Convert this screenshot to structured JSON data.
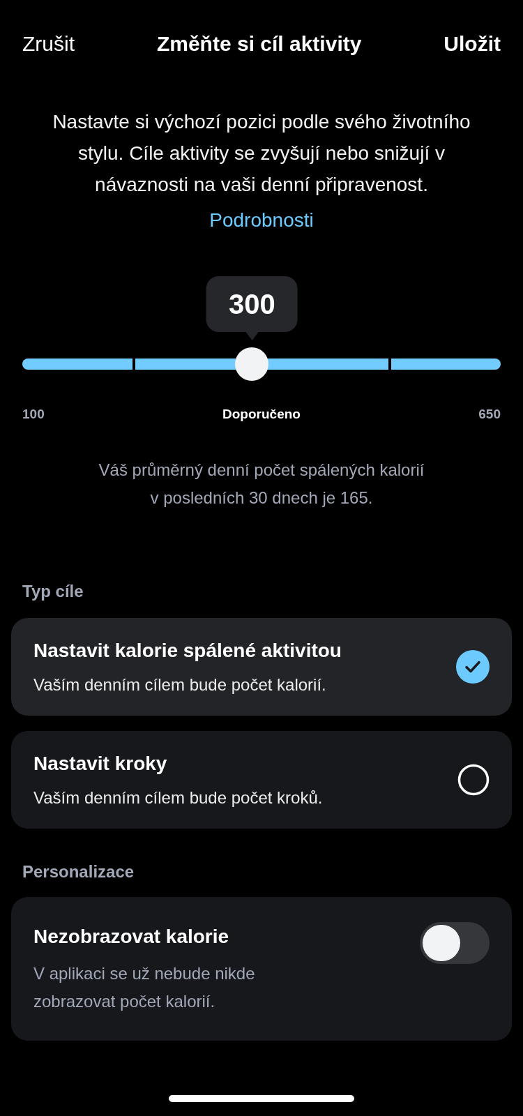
{
  "header": {
    "cancel": "Zrušit",
    "title": "Změňte si cíl aktivity",
    "save": "Uložit"
  },
  "intro": {
    "text": "Nastavte si výchozí pozici podle svého životního stylu. Cíle aktivity se zvyšují nebo snižují v návaznosti na vaši denní připravenost.",
    "link": "Podrobnosti"
  },
  "slider": {
    "value": "300",
    "level": 0.48,
    "min_label": "100",
    "center_label": "Doporučeno",
    "max_label": "650"
  },
  "average_note": "Váš průměrný denní počet spálených kalorií v posledních 30 dnech je 165.",
  "goal_type": {
    "heading": "Typ cíle",
    "options": [
      {
        "title": "Nastavit kalorie spálené aktivitou",
        "subtitle": "Vaším denním cílem bude počet kalorií.",
        "selected": true
      },
      {
        "title": "Nastavit kroky",
        "subtitle": "Vaším denním cílem bude počet kroků.",
        "selected": false
      }
    ]
  },
  "personalization": {
    "heading": "Personalizace",
    "items": [
      {
        "title": "Nezobrazovat kalorie",
        "subtitle": "V aplikaci se už nebude nikde zobrazovat počet kalorií.",
        "on": false
      }
    ]
  }
}
